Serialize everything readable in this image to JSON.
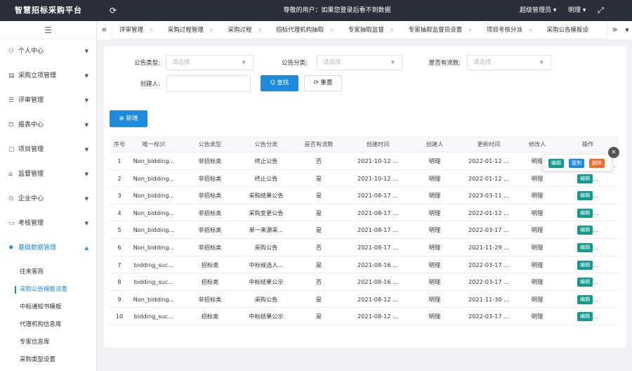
{
  "app": {
    "title": "智慧招标采购平台",
    "refresh_icon": "refresh-icon",
    "notice": "尊敬的用户：如果您登录后看不到数据",
    "user_role": "超级管理员 ▾",
    "user_name": "明理 ▾",
    "fullscreen_icon": "expand-icon"
  },
  "sidebar": {
    "collapse_icon": "menu-icon",
    "items": [
      {
        "label": "个人中心",
        "icon": "user-icon",
        "glyph": "⚇",
        "caret": "▼"
      },
      {
        "label": "采购立项管理",
        "icon": "project-icon",
        "glyph": "▤",
        "caret": "▼"
      },
      {
        "label": "评审管理",
        "icon": "list-icon",
        "glyph": "☰",
        "caret": "▼"
      },
      {
        "label": "报表中心",
        "icon": "report-icon",
        "glyph": "⊡",
        "caret": "▼"
      },
      {
        "label": "项目管理",
        "icon": "folder-icon",
        "glyph": "▢",
        "caret": "▼"
      },
      {
        "label": "监督管理",
        "icon": "shield-icon",
        "glyph": "⌂",
        "caret": "▼"
      },
      {
        "label": "企业中心",
        "icon": "building-icon",
        "glyph": "⊙",
        "caret": "▼"
      },
      {
        "label": "考核管理",
        "icon": "check-icon",
        "glyph": "▭",
        "caret": "▼"
      },
      {
        "label": "基础数据管理",
        "icon": "gear-icon",
        "glyph": "✹",
        "caret": "▲"
      }
    ],
    "sub_items": [
      {
        "label": "往来客商"
      },
      {
        "label": "采购公告模板设置"
      },
      {
        "label": "中标通知书模板"
      },
      {
        "label": "代理机构信息库"
      },
      {
        "label": "专家信息库"
      },
      {
        "label": "采购类型设置"
      }
    ]
  },
  "tabs": {
    "prev_icon": "double-chevron-left-icon",
    "next_icon": "double-chevron-right-icon",
    "more_icon": "chevron-down-icon",
    "close_glyph": "×",
    "items": [
      {
        "label": "评审管理"
      },
      {
        "label": "采购过程管理"
      },
      {
        "label": "采购过程"
      },
      {
        "label": "招标代理机构抽取"
      },
      {
        "label": "专家抽取监督"
      },
      {
        "label": "专家抽取监督员设置"
      },
      {
        "label": "项目考核分派"
      },
      {
        "label": "采购公告模板设"
      }
    ]
  },
  "filters": {
    "type_label": "公告类型:",
    "type_placeholder": "请选择",
    "category_label": "公告分类:",
    "category_placeholder": "请选择",
    "flow_label": "是否有流数:",
    "flow_placeholder": "请选择",
    "creator_label": "创建人:",
    "creator_value": "",
    "search_label": "Q 查找",
    "reset_label": "⟳ 重置",
    "add_label": "⊕ 新增"
  },
  "table": {
    "headers": [
      "序号",
      "唯一标识",
      "公告类型",
      "公告分类",
      "是否有流数",
      "创建时间",
      "创建人",
      "更新时间",
      "修改人",
      "操作"
    ],
    "rows": [
      [
        "1",
        "Non_bidding...",
        "非招标类",
        "终止公告",
        "否",
        "2021-10-12 ...",
        "明理",
        "2022-01-12 ...",
        "明理",
        ""
      ],
      [
        "2",
        "Non_bidding...",
        "非招标类",
        "终止公告",
        "是",
        "2021-10-12 ...",
        "明理",
        "2022-01-12 ...",
        "明理",
        "..."
      ],
      [
        "3",
        "Non_bidding...",
        "非招标类",
        "采购结果公告",
        "是",
        "2021-08-17 ...",
        "明理",
        "2023-03-11 ...",
        "明理",
        "..."
      ],
      [
        "4",
        "Non_bidding...",
        "非招标类",
        "采购变更公告",
        "是",
        "2021-08-17 ...",
        "明理",
        "2022-01-12 ...",
        "明理",
        "..."
      ],
      [
        "5",
        "Non_bidding...",
        "非招标类",
        "单一来源采...",
        "是",
        "2021-08-17 ...",
        "明理",
        "2022-03-17 ...",
        "明理",
        "..."
      ],
      [
        "6",
        "Non_bidding...",
        "非招标类",
        "采购公告",
        "否",
        "2021-08-17 ...",
        "明理",
        "2021-11-29 ...",
        "明理",
        "..."
      ],
      [
        "7",
        "bidding_suc...",
        "招标类",
        "中标候选人...",
        "是",
        "2021-08-16 ...",
        "明理",
        "2022-03-17 ...",
        "明理",
        "..."
      ],
      [
        "8",
        "bidding_suc...",
        "招标类",
        "中标结果公示",
        "否",
        "2021-08-16 ...",
        "明理",
        "2022-03-17 ...",
        "明理",
        "..."
      ],
      [
        "9",
        "Non_bidding...",
        "非招标类",
        "采购公告",
        "是",
        "2021-08-12 ...",
        "明理",
        "2021-11-30 ...",
        "明理",
        "..."
      ],
      [
        "10",
        "bidding_suc...",
        "招标类",
        "中标结果公示",
        "是",
        "2021-08-12 ...",
        "明理",
        "2022-03-17 ...",
        "明理",
        "..."
      ]
    ],
    "edit_label": "编辑",
    "more_label": "..."
  },
  "row_popover": {
    "edit_label": "编辑",
    "copy_label": "复制",
    "delete_label": "删除",
    "edit_color": "#129b8e",
    "copy_color": "#1e8bde",
    "delete_color": "#f26b2e",
    "close_icon": "close-icon",
    "close_glyph": "✕",
    "scroll_glyph": "⌄"
  },
  "colors": {
    "primary": "#1e8bde",
    "topbar": "#2b2f3a",
    "edit_tag": "#129b8e"
  }
}
